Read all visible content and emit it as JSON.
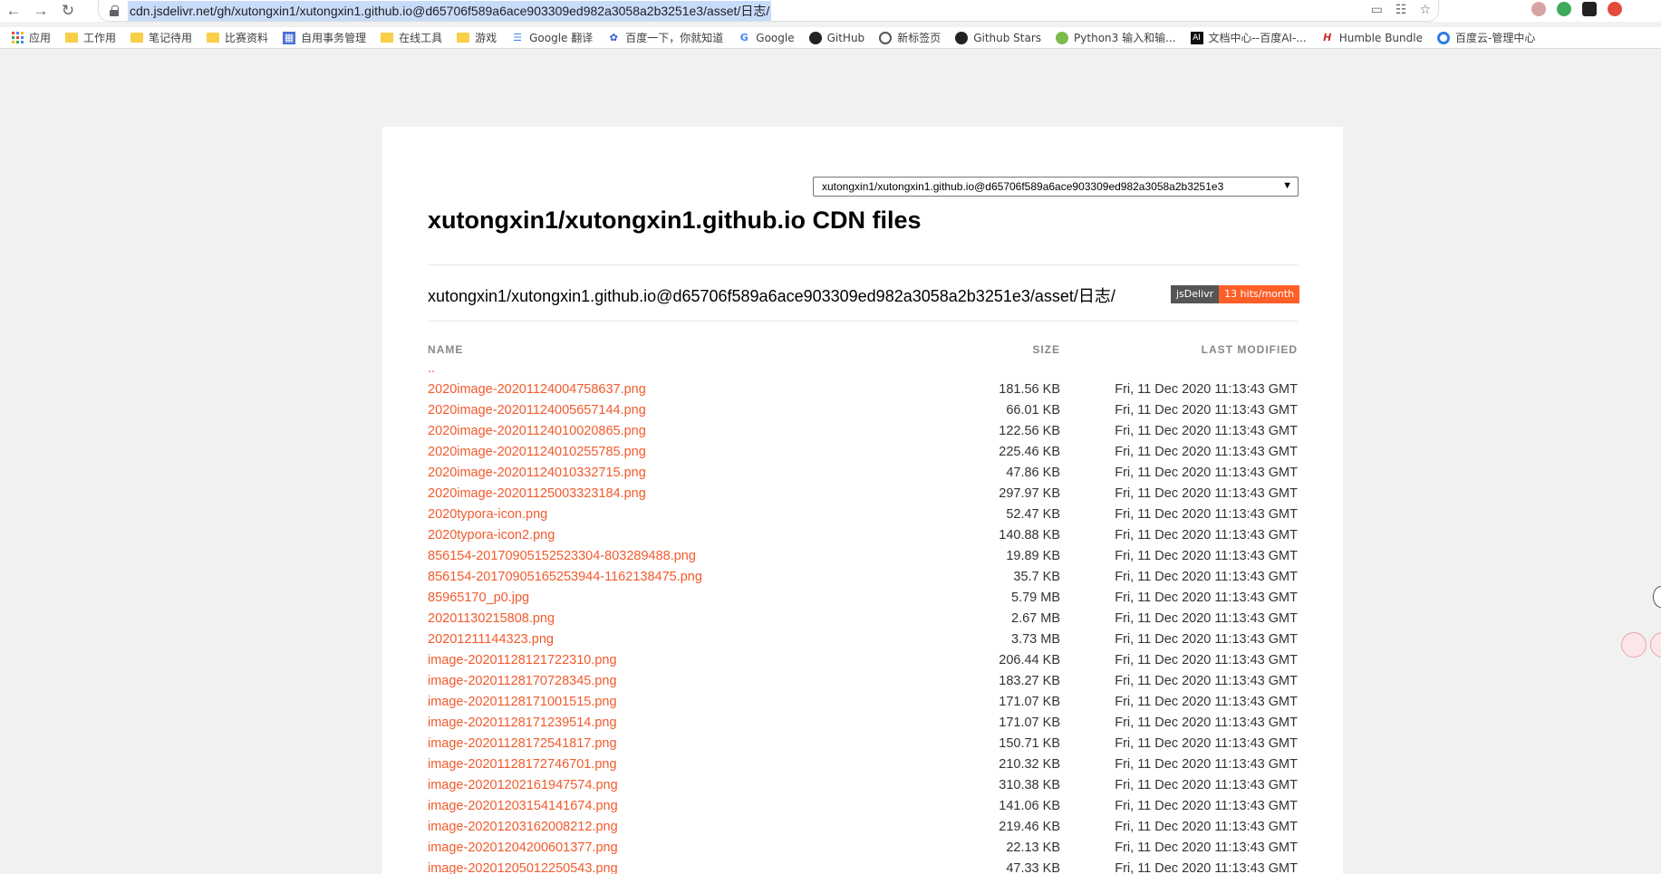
{
  "browser": {
    "url": "cdn.jsdelivr.net/gh/xutongxin1/xutongxin1.github.io@d65706f589a6ace903309ed982a3058a2b3251e3/asset/日志/",
    "bookmarks": [
      "应用",
      "工作用",
      "笔记待用",
      "比赛资料",
      "自用事务管理",
      "在线工具",
      "游戏",
      "Google 翻译",
      "百度一下，你就知道",
      "Google",
      "GitHub",
      "新标签页",
      "Github Stars",
      "Python3 输入和输...",
      "文档中心--百度AI-...",
      "Humble Bundle",
      "百度云-管理中心"
    ]
  },
  "page": {
    "select_value": "xutongxin1/xutongxin1.github.io@d65706f589a6ace903309ed982a3058a2b3251e3",
    "title": "xutongxin1/xutongxin1.github.io CDN files",
    "path": "xutongxin1/xutongxin1.github.io@d65706f589a6ace903309ed982a3058a2b3251e3/asset/日志/",
    "badge_left": "jsDelivr",
    "badge_right": "13 hits/month",
    "columns": {
      "name": "NAME",
      "size": "SIZE",
      "modified": "LAST MODIFIED"
    },
    "parent_link": "..",
    "files": [
      {
        "name": "2020image-20201124004758637.png",
        "size": "181.56 KB",
        "modified": "Fri, 11 Dec 2020 11:13:43 GMT"
      },
      {
        "name": "2020image-20201124005657144.png",
        "size": "66.01 KB",
        "modified": "Fri, 11 Dec 2020 11:13:43 GMT"
      },
      {
        "name": "2020image-20201124010020865.png",
        "size": "122.56 KB",
        "modified": "Fri, 11 Dec 2020 11:13:43 GMT"
      },
      {
        "name": "2020image-20201124010255785.png",
        "size": "225.46 KB",
        "modified": "Fri, 11 Dec 2020 11:13:43 GMT"
      },
      {
        "name": "2020image-20201124010332715.png",
        "size": "47.86 KB",
        "modified": "Fri, 11 Dec 2020 11:13:43 GMT"
      },
      {
        "name": "2020image-20201125003323184.png",
        "size": "297.97 KB",
        "modified": "Fri, 11 Dec 2020 11:13:43 GMT"
      },
      {
        "name": "2020typora-icon.png",
        "size": "52.47 KB",
        "modified": "Fri, 11 Dec 2020 11:13:43 GMT"
      },
      {
        "name": "2020typora-icon2.png",
        "size": "140.88 KB",
        "modified": "Fri, 11 Dec 2020 11:13:43 GMT"
      },
      {
        "name": "856154-20170905152523304-803289488.png",
        "size": "19.89 KB",
        "modified": "Fri, 11 Dec 2020 11:13:43 GMT"
      },
      {
        "name": "856154-20170905165253944-1162138475.png",
        "size": "35.7 KB",
        "modified": "Fri, 11 Dec 2020 11:13:43 GMT"
      },
      {
        "name": "85965170_p0.jpg",
        "size": "5.79 MB",
        "modified": "Fri, 11 Dec 2020 11:13:43 GMT"
      },
      {
        "name": "20201130215808.png",
        "size": "2.67 MB",
        "modified": "Fri, 11 Dec 2020 11:13:43 GMT"
      },
      {
        "name": "20201211144323.png",
        "size": "3.73 MB",
        "modified": "Fri, 11 Dec 2020 11:13:43 GMT"
      },
      {
        "name": "image-20201128121722310.png",
        "size": "206.44 KB",
        "modified": "Fri, 11 Dec 2020 11:13:43 GMT"
      },
      {
        "name": "image-20201128170728345.png",
        "size": "183.27 KB",
        "modified": "Fri, 11 Dec 2020 11:13:43 GMT"
      },
      {
        "name": "image-20201128171001515.png",
        "size": "171.07 KB",
        "modified": "Fri, 11 Dec 2020 11:13:43 GMT"
      },
      {
        "name": "image-20201128171239514.png",
        "size": "171.07 KB",
        "modified": "Fri, 11 Dec 2020 11:13:43 GMT"
      },
      {
        "name": "image-20201128172541817.png",
        "size": "150.71 KB",
        "modified": "Fri, 11 Dec 2020 11:13:43 GMT"
      },
      {
        "name": "image-20201128172746701.png",
        "size": "210.32 KB",
        "modified": "Fri, 11 Dec 2020 11:13:43 GMT"
      },
      {
        "name": "image-20201202161947574.png",
        "size": "310.38 KB",
        "modified": "Fri, 11 Dec 2020 11:13:43 GMT"
      },
      {
        "name": "image-20201203154141674.png",
        "size": "141.06 KB",
        "modified": "Fri, 11 Dec 2020 11:13:43 GMT"
      },
      {
        "name": "image-20201203162008212.png",
        "size": "219.46 KB",
        "modified": "Fri, 11 Dec 2020 11:13:43 GMT"
      },
      {
        "name": "image-20201204200601377.png",
        "size": "22.13 KB",
        "modified": "Fri, 11 Dec 2020 11:13:43 GMT"
      },
      {
        "name": "image-20201205012250543.png",
        "size": "47.33 KB",
        "modified": "Fri, 11 Dec 2020 11:13:43 GMT"
      }
    ]
  }
}
